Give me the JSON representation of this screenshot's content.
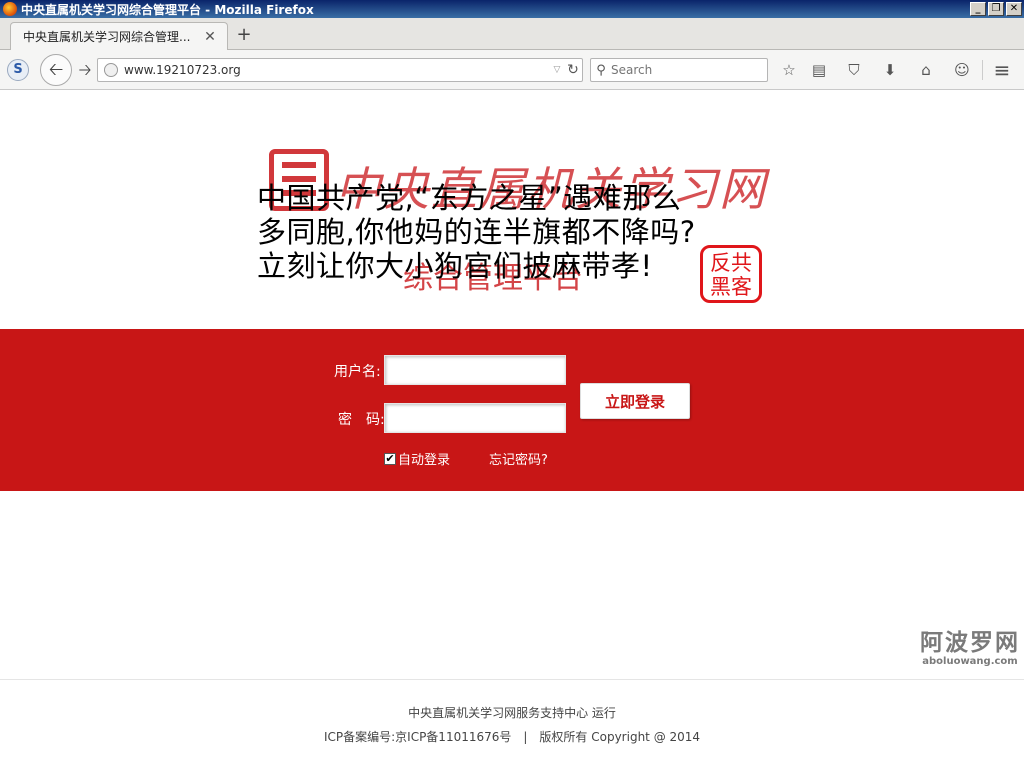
{
  "window": {
    "title": "中央直属机关学习网综合管理平台 - Mozilla Firefox",
    "buttons": [
      "_",
      "❐",
      "✕"
    ]
  },
  "tabs": [
    {
      "label": "中央直属机关学习网综合管理...",
      "active": true
    }
  ],
  "toolbar": {
    "url": "www.19210723.org",
    "search_placeholder": "Search"
  },
  "icons": {
    "s": "S",
    "back": "🡠",
    "forward": "🡢",
    "reload": "↻",
    "dropdown": "▽",
    "magnifier": "⚲",
    "bookmark_star": "☆",
    "reader": "▤",
    "pocket": "⛉",
    "download": "⬇",
    "home": "⌂",
    "chat": "☺",
    "menu": "≡",
    "new_tab": "+",
    "tab_close": "✕",
    "checkmark": "✔"
  },
  "banner": {
    "logo_text": "中央直属机关学习网",
    "subtitle": "综合管理平台",
    "defacement_lines": [
      "中国共产党,“东方之星”遇难那么",
      "多同胞,你他妈的连半旗都不降吗?",
      "立刻让你大小狗官们披麻带孝!"
    ],
    "stamp_lines": [
      "反共",
      "黑客"
    ]
  },
  "login": {
    "username_label": "用户名:",
    "password_label": "密　码:",
    "submit_label": "立即登录",
    "auto_login_label": "自动登录",
    "auto_login_checked": true,
    "forgot_label": "忘记密码?"
  },
  "footer": {
    "line1": "中央直属机关学习网服务支持中心 运行",
    "line2": "ICP备案编号:京ICP备11011676号　|　版权所有 Copyright @ 2014"
  },
  "watermark": {
    "cn": "阿波罗网",
    "en": "aboluowang.com"
  },
  "colors": {
    "accent_red": "#c81616",
    "titlebar_blue": "#0a246a"
  }
}
